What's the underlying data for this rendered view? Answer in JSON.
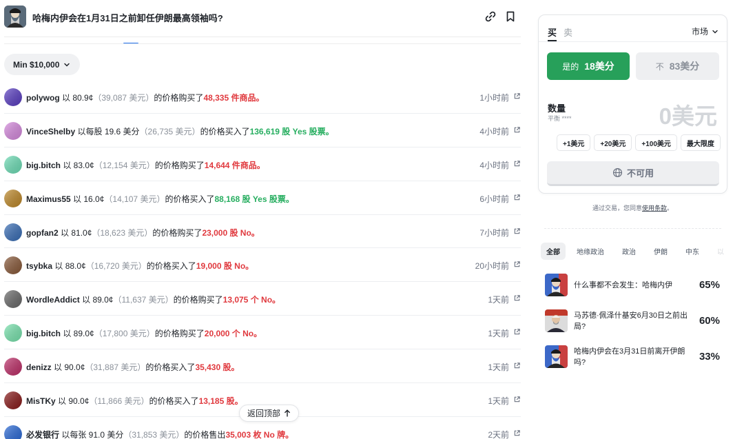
{
  "header": {
    "title": "哈梅内伊会在1月31日之前卸任伊朗最高领袖吗?",
    "icons": [
      "link-icon",
      "bookmark-icon"
    ]
  },
  "filter": {
    "label": "Min $10,000"
  },
  "activity": [
    {
      "user": "polywog",
      "price": " 以 80.9¢",
      "usd": "（39,087 美元）",
      "mid": "的价格购买了",
      "amount": "48,335 件商品。",
      "color": "red",
      "time": "1小时前",
      "avatar": "#5b3fc4"
    },
    {
      "user": "VinceShelby",
      "price": " 以每股 19.6 美分",
      "usd": "（26,735 美元）",
      "mid": "的价格买入了",
      "amount": "136,619 股 Yes 股票。",
      "color": "green",
      "time": "4小时前",
      "avatar": "#d88be0"
    },
    {
      "user": "big.bitch",
      "price": " 以 83.0¢",
      "usd": "（12,154 美元）",
      "mid": "的价格购买了",
      "amount": "14,644 件商品。",
      "color": "red",
      "time": "4小时前",
      "avatar": "#6fe0b8"
    },
    {
      "user": "Maximus55",
      "price": " 以 16.0¢",
      "usd": "（14,107 美元）",
      "mid": "的价格买入了",
      "amount": "88,168 股 Yes 股票。",
      "color": "green",
      "time": "6小时前",
      "avatar": "#c08a2a"
    },
    {
      "user": "gopfan2",
      "price": " 以 81.0¢",
      "usd": "（18,623 美元）",
      "mid": "的价格购买了",
      "amount": "23,000 股 No。",
      "color": "red",
      "time": "7小时前",
      "avatar": "#3a6fb8"
    },
    {
      "user": "tsybka",
      "price": " 以 88.0¢",
      "usd": "（16,720 美元）",
      "mid": "的价格买入了",
      "amount": "19,000 股 No。",
      "color": "red",
      "time": "20小时前",
      "avatar": "#8a5a3a"
    },
    {
      "user": "WordleAddict",
      "price": " 以 89.0¢",
      "usd": "（11,637 美元）",
      "mid": "的价格购买了",
      "amount": "13,075 个 No。",
      "color": "red",
      "time": "1天前",
      "avatar": "#6a6a6a"
    },
    {
      "user": "big.bitch",
      "price": " 以 89.0¢",
      "usd": "（17,800 美元）",
      "mid": "的价格购买了",
      "amount": "20,000 个 No。",
      "color": "red",
      "time": "1天前",
      "avatar": "#7ae6b0"
    },
    {
      "user": "denizz",
      "price": " 以 90.0¢",
      "usd": "（31,887 美元）",
      "mid": "的价格买入了",
      "amount": "35,430 股。",
      "color": "red",
      "time": "1天前",
      "avatar": "#c0306a"
    },
    {
      "user": "MisTKy",
      "price": " 以 90.0¢",
      "usd": "（11,866 美元）",
      "mid": "的价格买入了",
      "amount": "13,185 股。",
      "color": "red",
      "time": "1天前",
      "avatar": "#8a1a1a"
    },
    {
      "user": "必发银行",
      "price": " 以每张 91.0 美分",
      "usd": "（31,853 美元）",
      "mid": "的价格售出",
      "amount": "35,003 枚 No 牌。",
      "color": "red",
      "time": "2天前",
      "avatar": "#2a6ad8"
    }
  ],
  "back_to_top": "返回顶部",
  "trade": {
    "tab_buy": "买",
    "tab_sell": "卖",
    "market": "市场",
    "yes_label": "是的",
    "yes_price": "18美分",
    "no_label": "不",
    "no_price": "83美分",
    "qty_label": "数量",
    "balance": "平衡 ****",
    "qty_value": "0美元",
    "chips": [
      "+1美元",
      "+20美元",
      "+100美元",
      "最大限度"
    ],
    "unavailable": "不可用"
  },
  "terms": {
    "prefix": "通过交易，您同意",
    "link": "使用条款",
    "suffix": "。"
  },
  "categories": [
    "全部",
    "地缘政治",
    "政治",
    "伊朗",
    "中东",
    "以"
  ],
  "related": [
    {
      "title": "什么事都不会发生：哈梅内伊",
      "pct": "65%"
    },
    {
      "title": "马苏德·佩泽什基安6月30日之前出局?",
      "pct": "60%"
    },
    {
      "title": "哈梅内伊会在3月31日前离开伊朗吗?",
      "pct": "33%"
    }
  ],
  "colors": {
    "yes": "#27a05a",
    "red": "#e0393e",
    "green": "#27ae60"
  }
}
